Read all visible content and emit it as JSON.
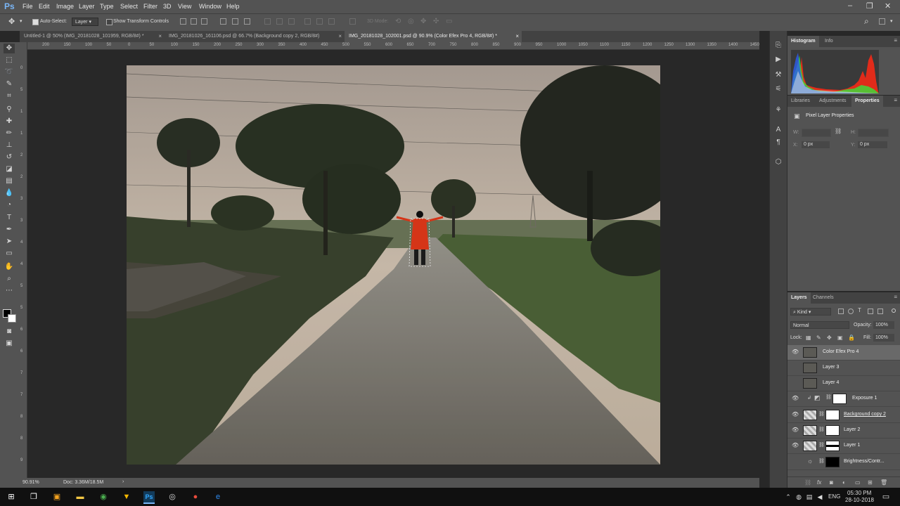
{
  "app": {
    "logo": "Ps",
    "menus": [
      "File",
      "Edit",
      "Image",
      "Layer",
      "Type",
      "Select",
      "Filter",
      "3D",
      "View",
      "Window",
      "Help"
    ],
    "window_controls": [
      "–",
      "❐",
      "✕"
    ]
  },
  "options_bar": {
    "auto_select_label": "Auto-Select:",
    "auto_select_value": "Layer",
    "show_transform_label": "Show Transform Controls",
    "mode_3d_label": "3D Mode:"
  },
  "tabs": [
    {
      "label": "Untitled-1 @ 50% (IMG_20181028_101959, RGB/8#) *",
      "close": "×"
    },
    {
      "label": "IMG_20181026_161106.psd @ 66.7% (Background copy 2, RGB/8#)",
      "close": "×"
    },
    {
      "label": "IMG_20181028_102001.psd @ 90.9% (Color Efex Pro 4, RGB/8#) *",
      "close": "×"
    }
  ],
  "rulers": {
    "horizontal": [
      "200",
      "150",
      "100",
      "50",
      "0",
      "50",
      "100",
      "150",
      "200",
      "250",
      "300",
      "350",
      "400",
      "450",
      "500",
      "550",
      "600",
      "650",
      "700",
      "750",
      "800",
      "850",
      "900",
      "950",
      "1000",
      "1050",
      "1100",
      "1150",
      "1200",
      "1250",
      "1300",
      "1350",
      "1400",
      "1450"
    ],
    "vertical": [
      "0",
      "5",
      "1",
      "1",
      "2",
      "2",
      "3",
      "3",
      "4",
      "4",
      "5",
      "5",
      "6",
      "6",
      "7",
      "7",
      "8",
      "8",
      "9"
    ]
  },
  "status": {
    "zoom": "90.91%",
    "doc": "Doc: 3.36M/18.5M",
    "arrow": "›"
  },
  "histogram_panel": {
    "tabs": [
      "Histogram",
      "Info"
    ],
    "menu": "≡"
  },
  "properties_panel": {
    "tabs": [
      "Libraries",
      "Adjustments",
      "Properties"
    ],
    "title": "Pixel Layer Properties",
    "w_label": "W:",
    "h_label": "H:",
    "x_label": "X:",
    "x_value": "0 px",
    "y_label": "Y:",
    "y_value": "0 px"
  },
  "layers_panel": {
    "tabs": [
      "Layers",
      "Channels"
    ],
    "kind_label": "Kind",
    "blend_mode": "Normal",
    "opacity_label": "Opacity:",
    "opacity_value": "100%",
    "lock_label": "Lock:",
    "fill_label": "Fill:",
    "fill_value": "100%",
    "layers": [
      {
        "name": "Color Efex Pro 4",
        "visible": true,
        "selected": true
      },
      {
        "name": "Layer 3",
        "visible": false,
        "selected": false
      },
      {
        "name": "Layer 4",
        "visible": false,
        "selected": false
      },
      {
        "name": "Exposure 1",
        "visible": true,
        "selected": false
      },
      {
        "name": "Background copy 2",
        "visible": true,
        "selected": false
      },
      {
        "name": "Layer 2",
        "visible": true,
        "selected": false
      },
      {
        "name": "Layer 1",
        "visible": true,
        "selected": false
      },
      {
        "name": "Brightness/Contr...",
        "visible": false,
        "selected": false
      }
    ],
    "footer_icons": [
      "link-icon",
      "fx-icon",
      "mask-icon",
      "adjustment-icon",
      "folder-icon",
      "new-layer-icon",
      "trash-icon"
    ],
    "fx_label": "fx"
  },
  "taskbar": {
    "language": "ENG",
    "time": "05:30 PM",
    "date": "28-10-2018"
  },
  "colors": {
    "ui_dark": "#282828",
    "ui_mid": "#535353",
    "ui_panel_header": "#424242",
    "accent_blue": "#7ab6f7",
    "selection_red": "#e83a1b"
  }
}
